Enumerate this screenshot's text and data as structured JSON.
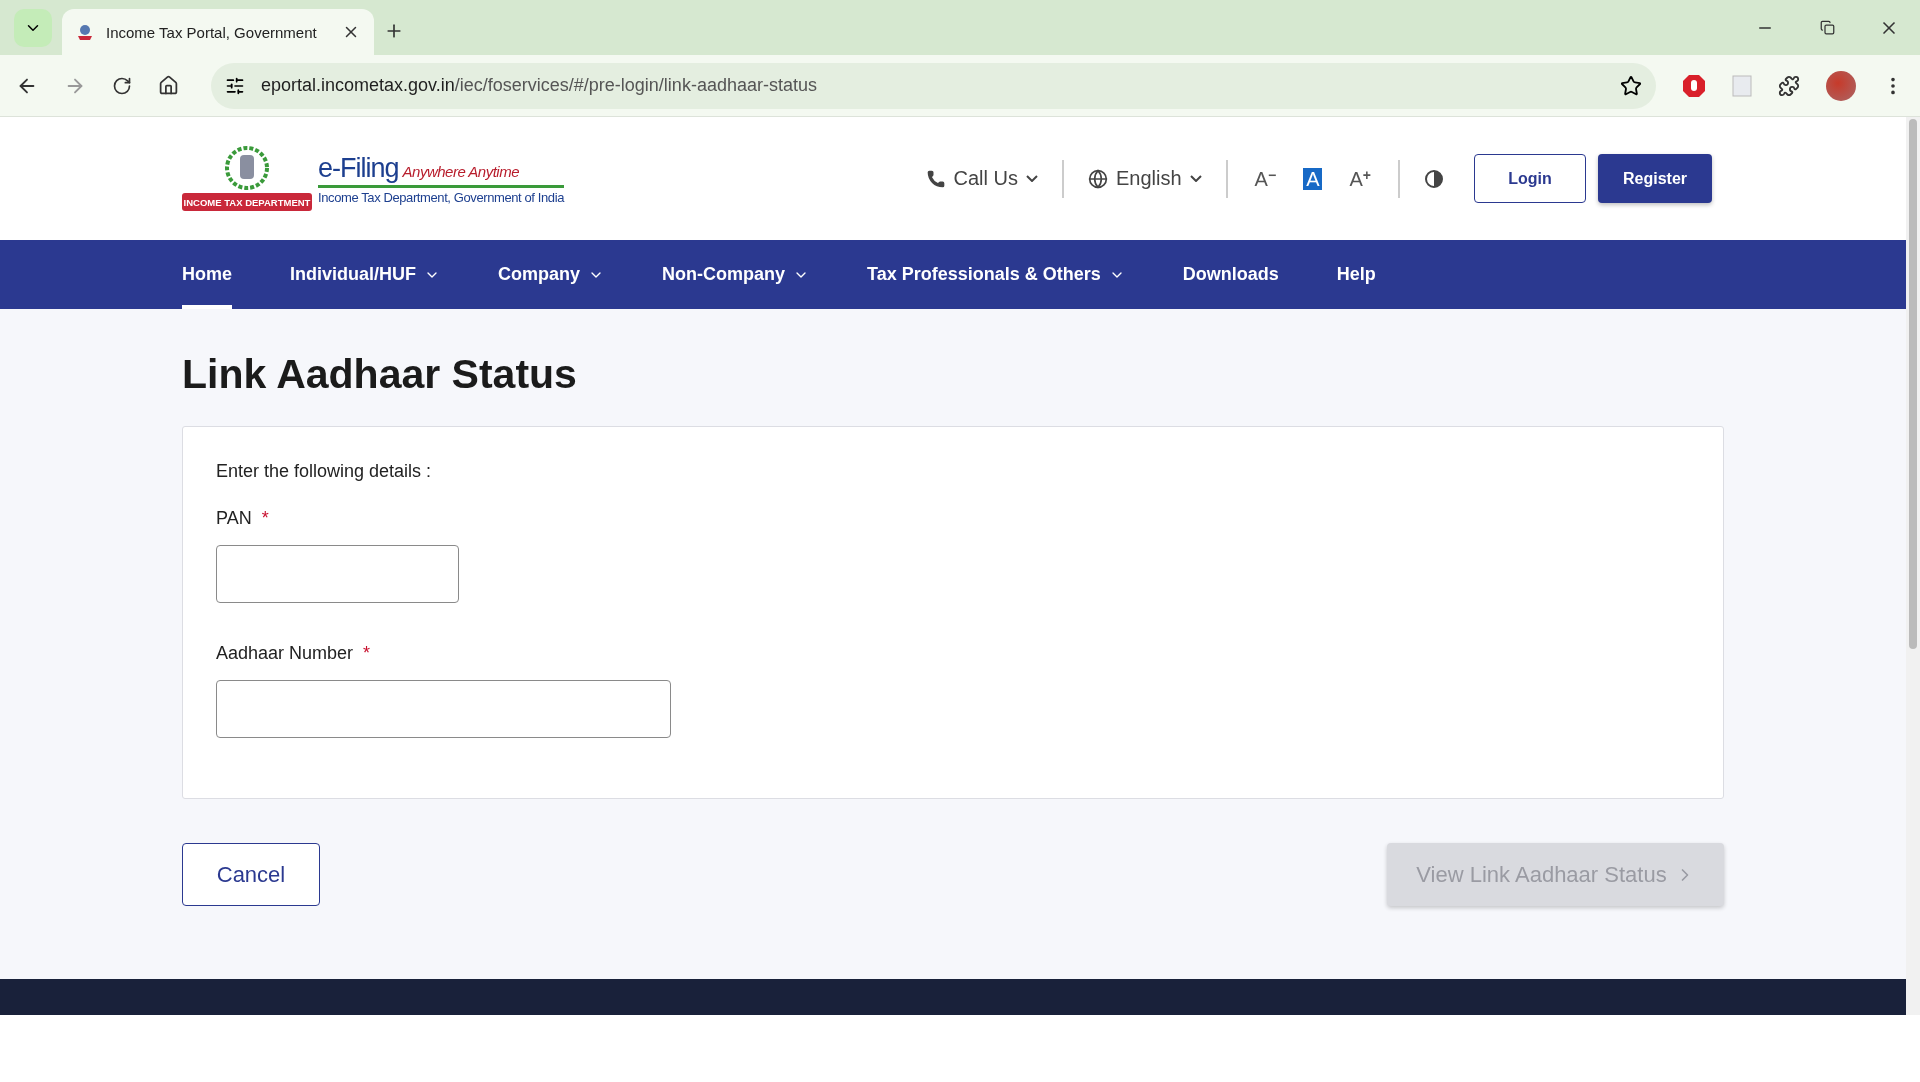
{
  "browser": {
    "tab": {
      "title": "Income Tax Portal, Government"
    },
    "url": {
      "host": "eportal.incometax.gov.in",
      "path": "/iec/foservices/#/pre-login/link-aadhaar-status"
    }
  },
  "header": {
    "logo": {
      "title": "e-Filing",
      "tagline": "Anywhere Anytime",
      "subtitle": "Income Tax Department, Government of India",
      "ribbon": "INCOME TAX DEPARTMENT"
    },
    "call_us": "Call Us",
    "language": "English",
    "font_controls": [
      {
        "letter": "A",
        "sign": "−",
        "selected": false
      },
      {
        "letter": "A",
        "selected": true
      },
      {
        "letter": "A",
        "sign": "+",
        "selected": false
      }
    ],
    "login": "Login",
    "register": "Register"
  },
  "nav": [
    {
      "label": "Home",
      "selected": true,
      "dropdown": false
    },
    {
      "label": "Individual/HUF",
      "selected": false,
      "dropdown": true
    },
    {
      "label": "Company",
      "selected": false,
      "dropdown": true
    },
    {
      "label": "Non-Company",
      "selected": false,
      "dropdown": true
    },
    {
      "label": "Tax Professionals & Others",
      "selected": false,
      "dropdown": true
    },
    {
      "label": "Downloads",
      "selected": false,
      "dropdown": false
    },
    {
      "label": "Help",
      "selected": false,
      "dropdown": false
    }
  ],
  "page": {
    "title": "Link Aadhaar Status",
    "intro": "Enter the following details :",
    "fields": [
      {
        "label": "PAN",
        "required_mark": "*",
        "kind": "short"
      },
      {
        "label": "Aadhaar Number",
        "required_mark": "*",
        "kind": "long"
      }
    ],
    "cancel": "Cancel",
    "submit": {
      "label": "View Link Aadhaar Status",
      "disabled": true
    }
  }
}
